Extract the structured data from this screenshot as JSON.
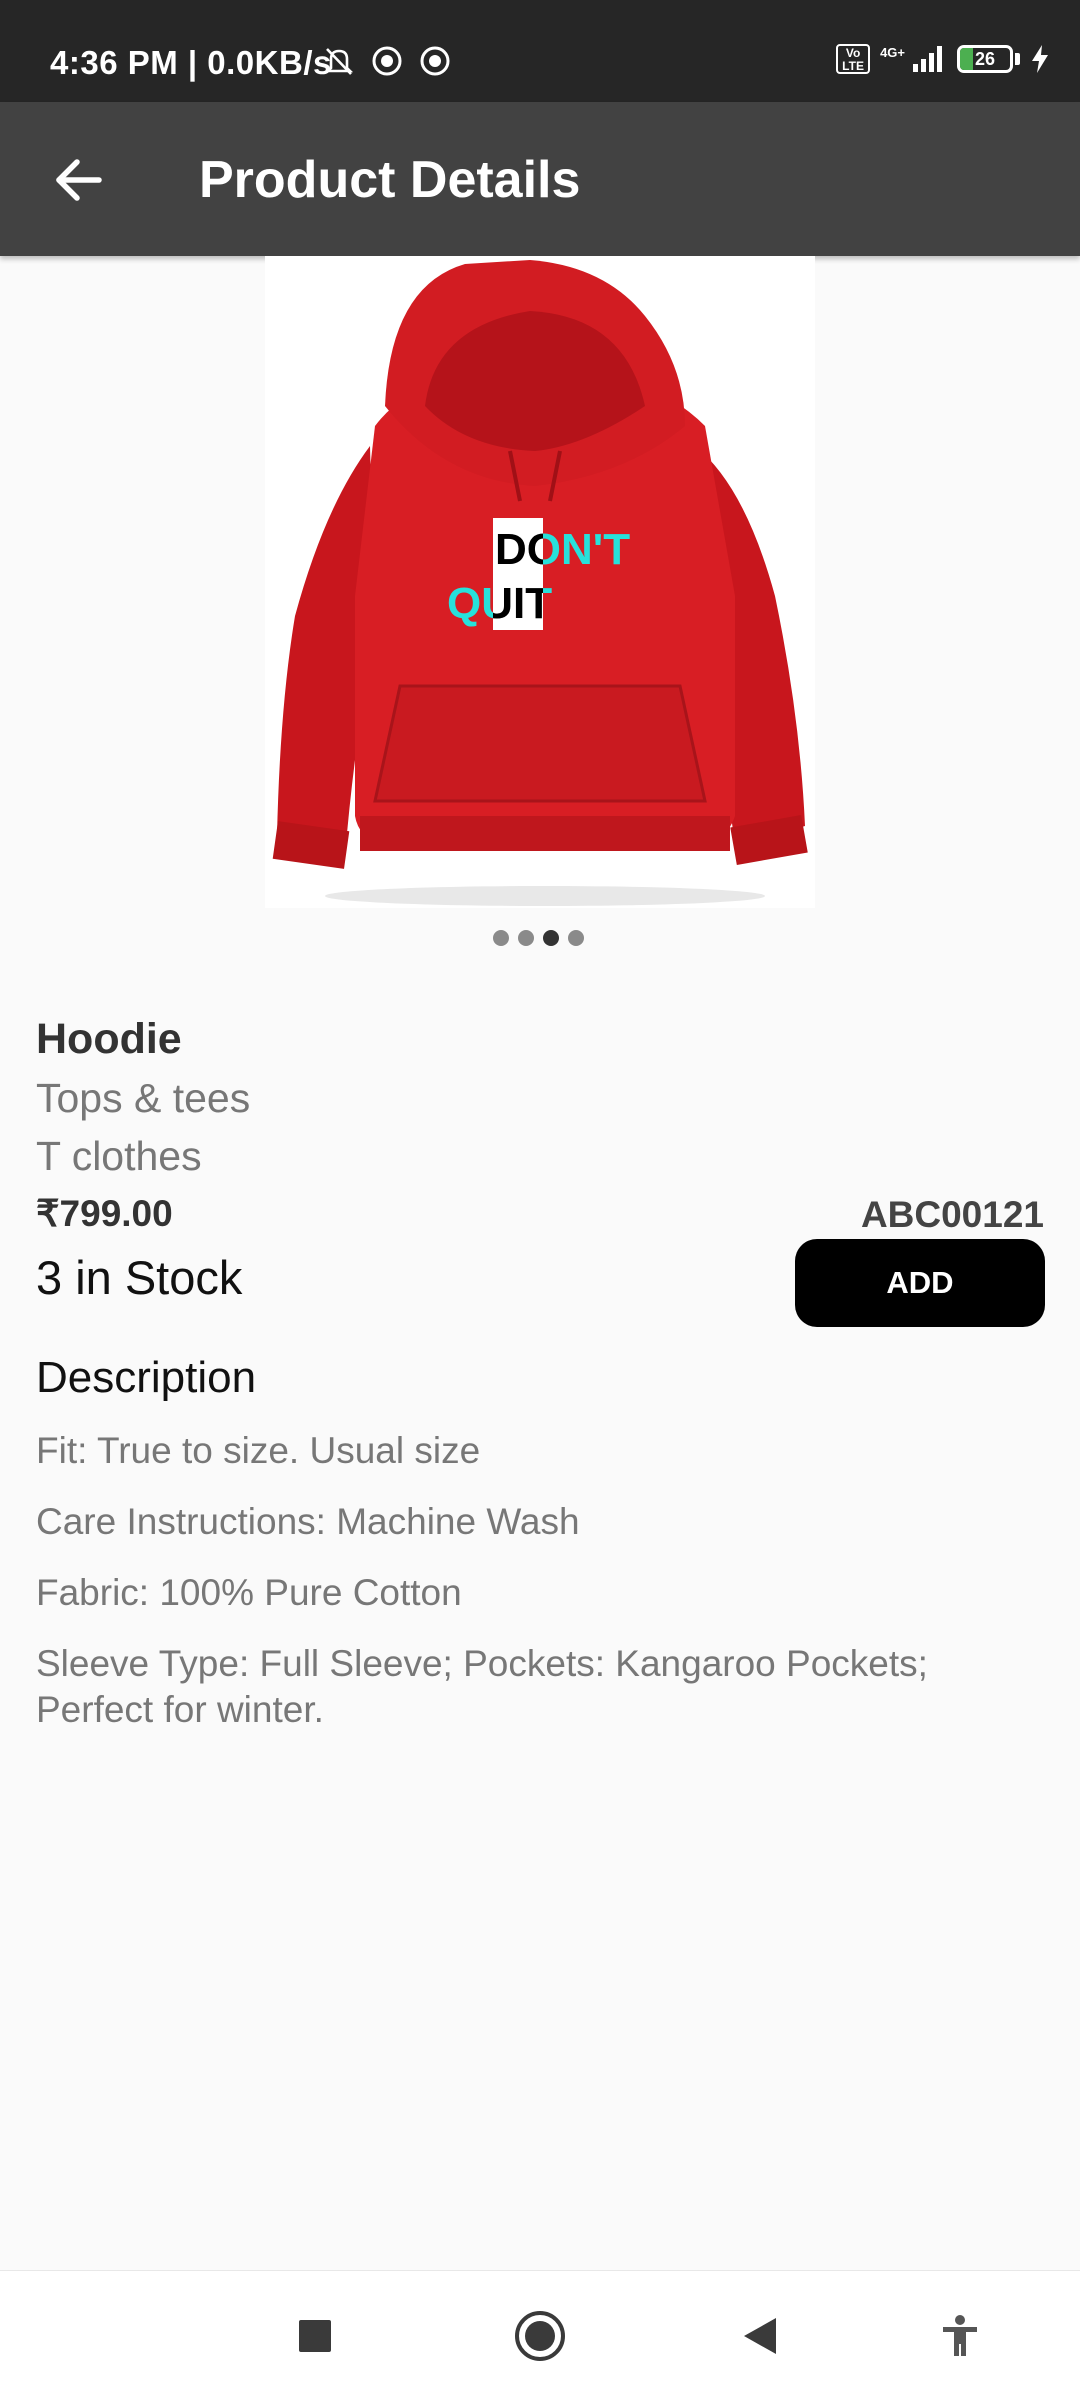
{
  "status_bar": {
    "time": "4:36 PM | 0.0KB/s",
    "network": "4G+",
    "volte": "Vo LTE",
    "battery": "26",
    "battery_level": 0.26
  },
  "app_bar": {
    "title": "Product Details"
  },
  "product": {
    "image_text_line1": "DON'T",
    "image_text_line2": "QUIT",
    "carousel_count": 4,
    "carousel_active": 2,
    "name": "Hoodie",
    "category": "Tops & tees",
    "subcategory": "T clothes",
    "price": "₹799.00",
    "sku": "ABC00121",
    "stock": "3 in Stock",
    "add_label": "ADD"
  },
  "description": {
    "title": "Description",
    "lines": [
      "Fit: True to size. Usual size",
      "Care Instructions: Machine Wash",
      "Fabric: 100% Pure Cotton",
      "Sleeve Type: Full Sleeve; Pockets: Kangaroo Pockets; Perfect for winter."
    ]
  },
  "colors": {
    "hoodie": "#d81e24",
    "app_bar": "#424242",
    "status_bar": "#262626",
    "button": "#000000"
  },
  "icons": {
    "back": "arrow-left",
    "nav": [
      "square",
      "circle",
      "triangle-back",
      "accessibility"
    ]
  }
}
